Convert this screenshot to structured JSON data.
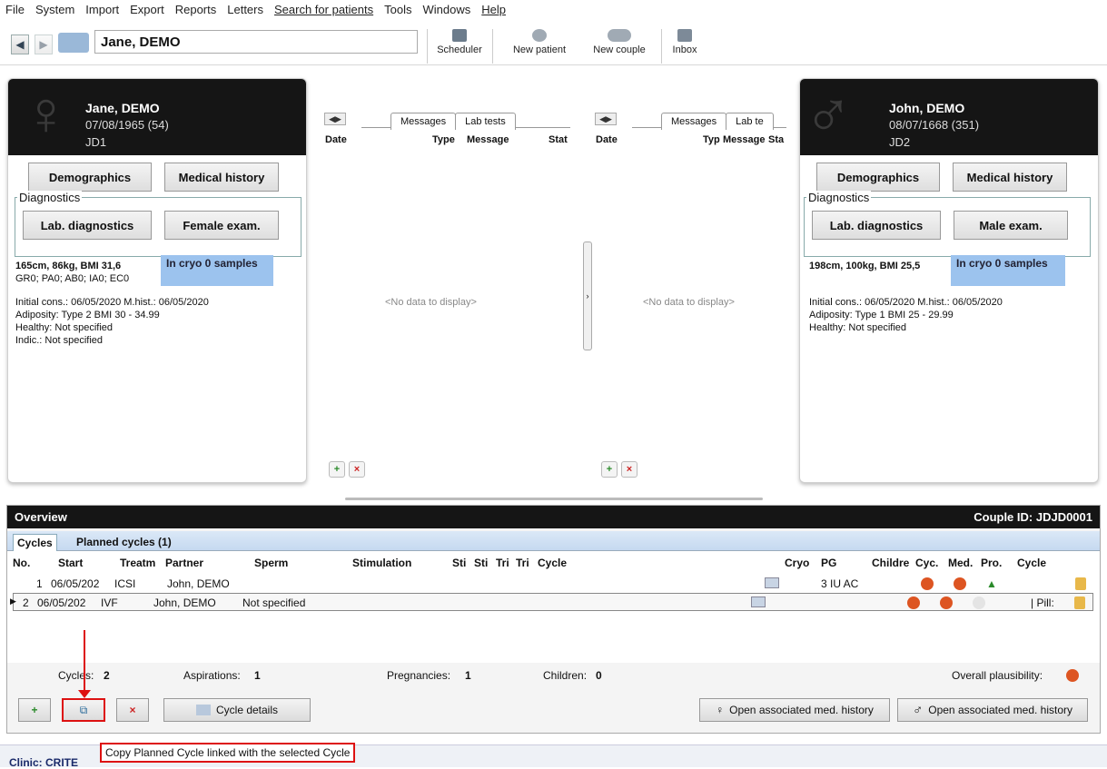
{
  "menu": [
    "File",
    "System",
    "Import",
    "Export",
    "Reports",
    "Letters",
    "Search for patients",
    "Tools",
    "Windows",
    "Help"
  ],
  "toolbar": {
    "patient": "Jane, DEMO",
    "scheduler": "Scheduler",
    "new_patient": "New patient",
    "new_couple": "New couple",
    "inbox": "Inbox"
  },
  "female": {
    "name": "Jane, DEMO",
    "dob": "07/08/1965  (54)",
    "id": "JD1",
    "demographics": "Demographics",
    "medical_history": "Medical history",
    "diagnostics_label": "Diagnostics",
    "lab_diag": "Lab. diagnostics",
    "exam": "Female exam.",
    "cryo": "In cryo 0 samples",
    "line1": "165cm, 86kg, BMI 31,6",
    "line2": "GR0; PA0; AB0; IA0; EC0",
    "line3": "Initial cons.: 06/05/2020  M.hist.: 06/05/2020",
    "line4": "Adiposity: Type 2 BMI 30 - 34.99",
    "line5": "Healthy: Not specified",
    "line6": "Indic.: Not specified"
  },
  "male": {
    "name": "John, DEMO",
    "dob": "08/07/1668  (351)",
    "id": "JD2",
    "demographics": "Demographics",
    "medical_history": "Medical history",
    "diagnostics_label": "Diagnostics",
    "lab_diag": "Lab. diagnostics",
    "exam": "Male exam.",
    "cryo": "In cryo 0 samples",
    "line1": "198cm, 100kg, BMI 25,5",
    "line3": "Initial cons.: 06/05/2020  M.hist.: 06/05/2020",
    "line4": "Adiposity: Type 1 BMI 25 - 29.99",
    "line5": "Healthy: Not specified"
  },
  "panel_left": {
    "tab1": "Messages",
    "tab2": "Lab tests",
    "c1": "Date",
    "c2": "Type",
    "c3": "Message",
    "c4": "Stat",
    "nodata": "<No data to display>"
  },
  "panel_right": {
    "tab1": "Messages",
    "tab2": "Lab te",
    "c1": "Date",
    "c2": "Typ",
    "c3": "Message",
    "c4": "Sta",
    "nodata": "<No data to display>"
  },
  "overview": {
    "title": "Overview",
    "couple_id": "Couple ID: JDJD0001",
    "tab_cycles": "Cycles",
    "tab_planned": "Planned cycles (1)",
    "headers": [
      "No.",
      "Start",
      "Treatm",
      "Partner",
      "Sperm",
      "Stimulation",
      "Sti",
      "Sti",
      "Tri",
      "Tri",
      "Cycle",
      "Cryo",
      "PG",
      "Childre",
      "Cyc.",
      "Med.",
      "Pro.",
      "Cycle"
    ],
    "rows": [
      {
        "no": "1",
        "start": "06/05/202",
        "treat": "ICSI",
        "partner": "John, DEMO",
        "sperm": "",
        "pg": "3 IU AC",
        "extra": ""
      },
      {
        "no": "2",
        "start": "06/05/202",
        "treat": "IVF",
        "partner": "John, DEMO",
        "sperm": "Not specified",
        "pg": "",
        "extra": "| Pill:"
      }
    ],
    "summary": {
      "cycles_label": "Cycles:",
      "cycles": "2",
      "asp_label": "Aspirations:",
      "asp": "1",
      "preg_label": "Pregnancies:",
      "preg": "1",
      "child_label": "Children:",
      "child": "0",
      "overall": "Overall plausibility:"
    },
    "cycle_details": "Cycle details",
    "open_female": "Open associated med. history",
    "open_male": "Open associated med. history"
  },
  "status": {
    "clinic": "Clinic:  CRITE"
  },
  "tooltip": "Copy Planned Cycle linked with the selected Cycle",
  "colors": {
    "accent_red": "#d11",
    "cryo_blue": "#9cc3ee",
    "header_black": "#151515"
  }
}
